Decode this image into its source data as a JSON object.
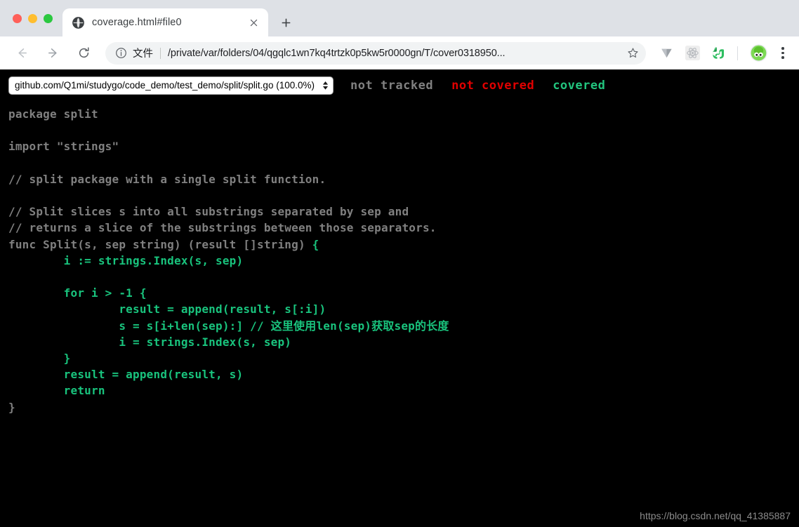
{
  "window": {
    "traffic_lights": [
      "close",
      "minimize",
      "zoom"
    ],
    "colors": {
      "close": "#ff6059",
      "minimize": "#ffbe2f",
      "zoom": "#2bc840",
      "chrome_bg": "#dee1e6",
      "toolbar_bg": "#ffffff",
      "page_bg": "#000000",
      "covered_green": "#19c37d",
      "not_covered_red": "#e00000",
      "not_tracked_gray": "#808080"
    }
  },
  "tabstrip": {
    "tab": {
      "favicon": "globe-icon",
      "title": "coverage.html#file0",
      "close_label": "×"
    },
    "new_tab_label": "+"
  },
  "toolbar": {
    "back_label": "←",
    "forward_label": "→",
    "reload_label": "⟳",
    "omnibox": {
      "info_icon": "info-circle-icon",
      "scheme_label": "文件",
      "url": "/private/var/folders/04/qgqlc1wn7kq4trtzk0p5kw5r0000gn/T/cover0318950...",
      "star_label": "☆"
    },
    "extensions": [
      {
        "name": "vimium-icon",
        "label": "V"
      },
      {
        "name": "react-devtools-icon",
        "label": "React"
      },
      {
        "name": "evernote-icon",
        "label": "Evernote"
      }
    ],
    "profile": {
      "name": "profile-avatar",
      "label": "Profile"
    },
    "menu_label": "⋮"
  },
  "coverage": {
    "file_select": {
      "selected": "github.com/Q1mi/studygo/code_demo/test_demo/split/split.go (100.0%)",
      "options": [
        "github.com/Q1mi/studygo/code_demo/test_demo/split/split.go (100.0%)"
      ]
    },
    "legend": {
      "not_tracked": "not tracked",
      "not_covered": "not covered",
      "covered": "covered"
    },
    "code_lines": [
      {
        "text": "package split",
        "cov": "cov0"
      },
      {
        "text": "",
        "cov": "cov0"
      },
      {
        "text": "import \"strings\"",
        "cov": "cov0"
      },
      {
        "text": "",
        "cov": "cov0"
      },
      {
        "text": "// split package with a single split function.",
        "cov": "cov0"
      },
      {
        "text": "",
        "cov": "cov0"
      },
      {
        "text": "// Split slices s into all substrings separated by sep and",
        "cov": "cov0"
      },
      {
        "text": "// returns a slice of the substrings between those separators.",
        "cov": "cov0"
      },
      {
        "text": "func Split(s, sep string) (result []string) ",
        "cov": "cov0",
        "tail": "{",
        "tail_cov": "cov8"
      },
      {
        "text": "        i := strings.Index(s, sep)",
        "cov": "cov8"
      },
      {
        "text": "",
        "cov": "cov8"
      },
      {
        "text": "        for i > -1 {",
        "cov": "cov8"
      },
      {
        "text": "                result = append(result, s[:i])",
        "cov": "cov8"
      },
      {
        "text": "                s = s[i+len(sep):] // 这里使用len(sep)获取sep的长度",
        "cov": "cov8"
      },
      {
        "text": "                i = strings.Index(s, sep)",
        "cov": "cov8"
      },
      {
        "text": "        }",
        "cov": "cov8"
      },
      {
        "text": "        result = append(result, s)",
        "cov": "cov8"
      },
      {
        "text": "        return",
        "cov": "cov8"
      },
      {
        "text": "}",
        "cov": "cov0"
      }
    ]
  },
  "watermark": "https://blog.csdn.net/qq_41385887"
}
